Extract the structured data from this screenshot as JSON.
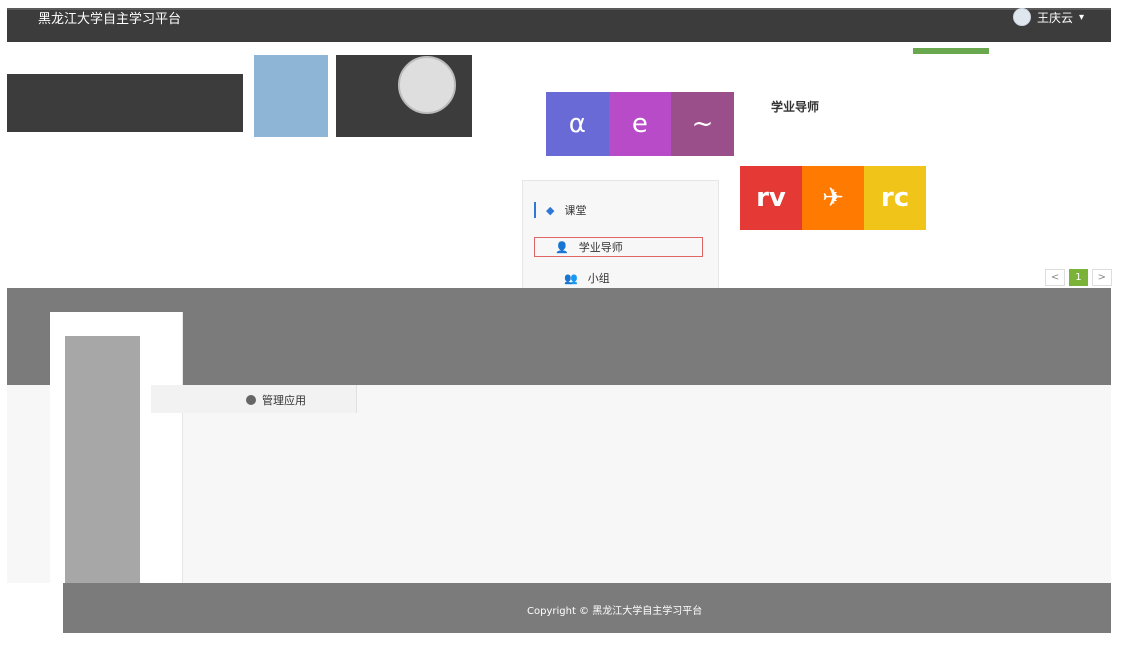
{
  "header": {
    "brand": "黑龙江大学自主学习平台",
    "user_name": "王庆云",
    "caret": "▾"
  },
  "menu": {
    "course": "课堂",
    "tutor": "学业导师",
    "group": "小组"
  },
  "panel": {
    "tutor_title": "学业导师"
  },
  "tiles_top": [
    "α",
    "e",
    "~"
  ],
  "tiles_bottom": [
    "rv",
    "✈",
    "rc"
  ],
  "manage": {
    "label": "管理应用"
  },
  "pagination": {
    "current": "1",
    "next": ">",
    "prev": "<"
  },
  "footer": {
    "copyright": "Copyright © 黑龙江大学自主学习平台"
  }
}
